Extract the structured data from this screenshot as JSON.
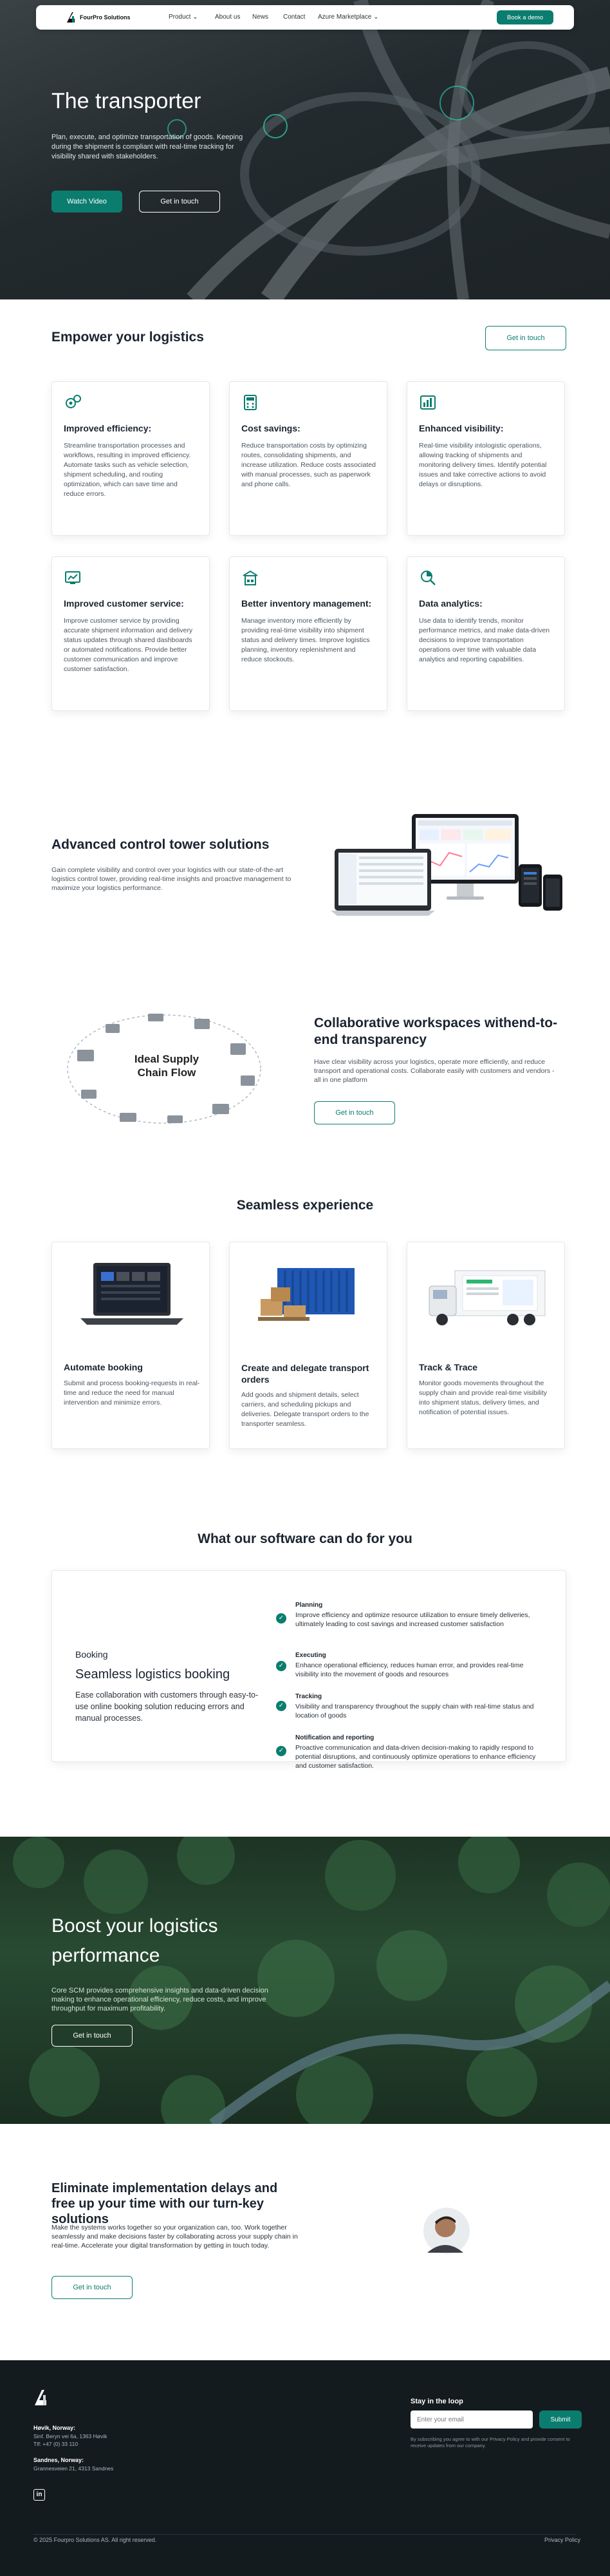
{
  "nav": {
    "brand": "FourPro Solutions",
    "items": [
      "Product",
      "About us",
      "News",
      "Contact",
      "Azure Marketplace"
    ],
    "cta": "Book a demo"
  },
  "hero": {
    "title": "The transporter",
    "text": "Plan, execute, and optimize transportation of goods. Keeping during the shipment is compliant with real-time tracking for visibility shared with stakeholders.",
    "watch_btn": "Watch Video",
    "contact_btn": "Get in touch"
  },
  "empower": {
    "title": "Empower your logistics",
    "cta": "Get in touch",
    "cards": [
      {
        "icon": "gears-icon",
        "title": "Improved efficiency:",
        "text": "Streamline transportation processes and workflows, resulting in improved efficiency. Automate tasks such as vehicle selection, shipment scheduling, and routing optimization, which can save time and reduce errors."
      },
      {
        "icon": "calculator-icon",
        "title": "Cost savings:",
        "text": "Reduce transportation costs by optimizing routes, consolidating shipments, and increase utilization. Reduce costs associated with manual processes, such as paperwork and phone calls."
      },
      {
        "icon": "dashboard-icon",
        "title": "Enhanced visibility:",
        "text": "Real-time visibility intologistic operations, allowing tracking of shipments and monitoring delivery times. Identify potential issues and take corrective actions to avoid delays or disruptions."
      },
      {
        "icon": "screen-chart-icon",
        "title": "Improved customer service:",
        "text": "Improve customer service by providing accurate shipment information and delivery status updates through shared dashboards or automated notifications. Provide better customer communication and improve customer satisfaction."
      },
      {
        "icon": "warehouse-icon",
        "title": "Better inventory management:",
        "text": "Manage inventory more efficiently by providing real-time visibility into shipment status and delivery times. Improve logistics planning, inventory replenishment and reduce stockouts."
      },
      {
        "icon": "analytics-icon",
        "title": "Data analytics:",
        "text": "Use data to identify trends, monitor performance metrics, and make data-driven decisions to improve transportation operations over time with valuable data analytics and reporting capabilities."
      }
    ]
  },
  "control_tower": {
    "title": "Advanced control tower solutions",
    "text": "Gain complete visibility and control over your logistics with our state-of-the-art logistics control tower, providing real-time insights and proactive management to maximize your logistics performance."
  },
  "collab": {
    "diagram_title": "Ideal Supply Chain Flow",
    "title": "Collaborative workspaces withend-to-end transparency",
    "text": "Have clear visibility across your logistics, operate more efficiently, and reduce transport and operational costs. Collaborate easily with customers and vendors - all in one platform",
    "cta": "Get in touch"
  },
  "seamless": {
    "title": "Seamless experience",
    "cards": [
      {
        "title": "Automate booking",
        "text": "Submit and process booking-requests in real-time and reduce the need for manual intervention and minimize errors."
      },
      {
        "title": "Create and delegate transport orders",
        "text": "Add goods and shipment details, select carriers, and scheduling pickups and deliveries. Delegate transport orders to the transporter seamless."
      },
      {
        "title": "Track & Trace",
        "text": "Monitor goods movements throughout the supply chain and provide real-time visibility into shipment status, delivery times, and notification of potential issues."
      }
    ]
  },
  "software": {
    "title": "What our software can do for you",
    "label": "Booking",
    "heading": "Seamless logistics booking",
    "text": "Ease collaboration with customers through easy-to-use online booking solution reducing errors and manual processes.",
    "features": [
      {
        "title": "Planning",
        "text": "Improve efficiency and optimize resource utilization to ensure timely deliveries, ultimately leading to cost savings and increased customer satisfaction"
      },
      {
        "title": "Executing",
        "text": "Enhance operational efficiency, reduces human error, and provides real-time visibility into the movement of goods and resources"
      },
      {
        "title": "Tracking",
        "text": "Visibility and transparency throughout the supply chain with real-time status and location of goods"
      },
      {
        "title": "Notification and reporting",
        "text": "Proactive communication and data-driven decision-making to rapidly respond to potential disruptions, and continuously optimize operations to enhance efficiency and customer satisfaction."
      }
    ]
  },
  "boost": {
    "title": "Boost your logistics performance",
    "text": "Core SCM provides comprehensive insights and data-driven decision making to enhance operational efficiency, reduce costs, and improve throughput for maximum profitability.",
    "cta": "Get in touch"
  },
  "turnkey": {
    "title": "Eliminate implementation delays and free up your time with our turn-key solutions",
    "text": "Make the systems works together so your organization can, too. Work together seamlessly and make decisions faster by collaborating across your supply chain in real-time. Accelerate your digital transformation by getting in touch today.",
    "cta": "Get in touch"
  },
  "footer": {
    "office1_title": "Høvik, Norway:",
    "office1_addr": "Sinf. Beryn vei 6a, 1363 Høvik",
    "office1_tel": "Tlf: +47 (0) 33 110",
    "office2_title": "Sandnes, Norway:",
    "office2_addr": "Grannesveien 21, 4313 Sandnes",
    "newsletter_title": "Stay in the loop",
    "email_placeholder": "Enter your email",
    "submit": "Submit",
    "consent": "By subscribing you agree to with our Privacy Policy and provide consent to receive updates from our company.",
    "copyright": "© 2025 Fourpro Solutions AS. All right reserved.",
    "privacy": "Privacy Policy"
  }
}
